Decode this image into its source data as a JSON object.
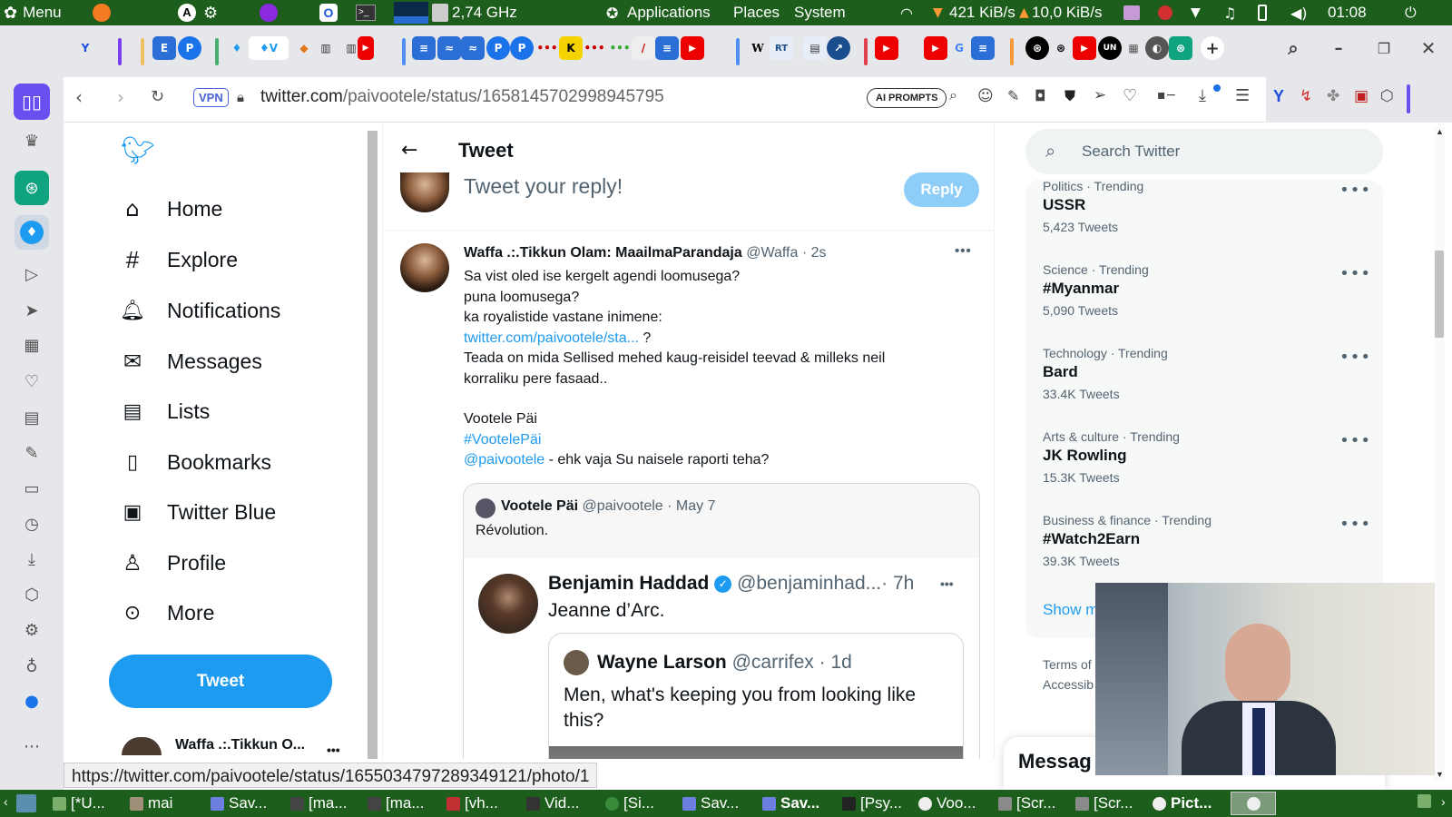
{
  "system_bar": {
    "menu": "Menu",
    "cpu_freq": "2,74 GHz",
    "applications": "Applications",
    "places": "Places",
    "system": "System",
    "net_down": "421 KiB/s",
    "net_up": "10,0 KiB/s",
    "clock": "01:08"
  },
  "browser": {
    "vpn": "VPN",
    "url_host": "twitter.com",
    "url_path": "/paivootele/status/1658145702998945795",
    "ai_prompts": "AI PROMPTS",
    "status_url": "https://twitter.com/paivootele/status/1655034797289349121/photo/1"
  },
  "nav": {
    "items": [
      {
        "label": "Home"
      },
      {
        "label": "Explore"
      },
      {
        "label": "Notifications"
      },
      {
        "label": "Messages"
      },
      {
        "label": "Lists"
      },
      {
        "label": "Bookmarks"
      },
      {
        "label": "Twitter Blue"
      },
      {
        "label": "Profile"
      },
      {
        "label": "More"
      }
    ],
    "tweet_button": "Tweet",
    "account_name": "Waffa .:.Tikkun O..."
  },
  "main": {
    "header": "Tweet",
    "reply_placeholder": "Tweet your reply!",
    "reply_button": "Reply",
    "tweet": {
      "author": "Waffa .:.Tikkun Olam: MaailmaParandaja",
      "handle": "@Waffa",
      "time": "· 2s",
      "lines": [
        "Sa vist oled ise kergelt agendi loomusega?",
        "puna loomusega?",
        "ka royalistide vastane inimene:"
      ],
      "link": "twitter.com/paivootele/sta...",
      "link_suffix": " ?",
      "line4": "Teada on mida Sellised mehed kaug-reisidel teevad & milleks neil",
      "line5": "korraliku pere fasaad..",
      "line6": "Vootele Päi",
      "hashtag": "#VootelePäi",
      "mention": "@paivootele",
      "mention_suffix": " - ehk vaja Su naisele raporti teha?"
    },
    "quote": {
      "author": "Vootele Päi",
      "handle": "@paivootele",
      "time": "· May 7",
      "text": "Révolution."
    },
    "inner": {
      "author": "Benjamin Haddad",
      "handle": "@benjaminhad...",
      "time": "· 7h",
      "text": "Jeanne d’Arc."
    },
    "inner2": {
      "author": "Wayne Larson",
      "handle": "@carrifex",
      "time": "· 1d",
      "text1": "Men, what's keeping you from looking like",
      "text2": "this?"
    }
  },
  "right": {
    "search_placeholder": "Search Twitter",
    "trends": [
      {
        "category": "Politics · Trending",
        "name": "USSR",
        "count": "5,423 Tweets"
      },
      {
        "category": "Science · Trending",
        "name": "#Myanmar",
        "count": "5,090 Tweets"
      },
      {
        "category": "Technology · Trending",
        "name": "Bard",
        "count": "33.4K Tweets"
      },
      {
        "category": "Arts & culture · Trending",
        "name": "JK Rowling",
        "count": "15.3K Tweets"
      },
      {
        "category": "Business & finance · Trending",
        "name": "#Watch2Earn",
        "count": "39.3K Tweets"
      }
    ],
    "show_more": "Show m",
    "terms": "Terms of",
    "accessibility": "Accessib",
    "messages": "Messag"
  },
  "taskbar": {
    "items": [
      "[*U...",
      "mai",
      "Sav...",
      "[ma...",
      "[ma...",
      "[vh...",
      "Vid...",
      "[Si...",
      "Sav...",
      "Sav...",
      "[Psy...",
      "Voo...",
      "[Scr...",
      "[Scr...",
      "Pict..."
    ]
  },
  "colors": {
    "twitter_blue": "#1d9bf0",
    "system_green": "#1d5e1d"
  }
}
